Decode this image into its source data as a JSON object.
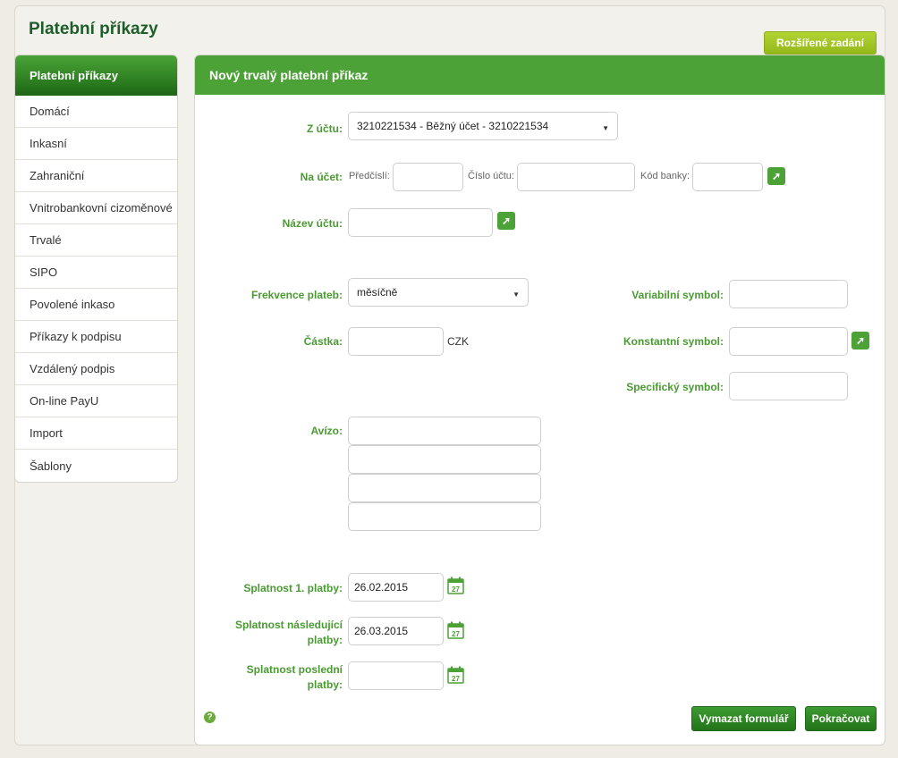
{
  "app": {
    "title": "Platební příkazy",
    "advanced_button": "Rozšířené zadání"
  },
  "sidebar": {
    "items": [
      {
        "label": "Platební příkazy",
        "active": true
      },
      {
        "label": "Domácí"
      },
      {
        "label": "Inkasní"
      },
      {
        "label": "Zahraniční"
      },
      {
        "label": "Vnitrobankovní cizoměnové"
      },
      {
        "label": "Trvalé"
      },
      {
        "label": "SIPO"
      },
      {
        "label": "Povolené inkaso"
      },
      {
        "label": "Příkazy k podpisu"
      },
      {
        "label": "Vzdálený podpis"
      },
      {
        "label": "On-line PayU"
      },
      {
        "label": "Import"
      },
      {
        "label": "Šablony"
      }
    ]
  },
  "form": {
    "heading": "Nový trvalý platební příkaz",
    "from_account": {
      "label": "Z účtu:",
      "value": "3210221534 - Běžný účet - 3210221534"
    },
    "to_account": {
      "label": "Na účet:",
      "prefix_label": "Předčíslí:",
      "prefix_value": "",
      "number_label": "Číslo účtu:",
      "number_value": "",
      "bank_label": "Kód banky:",
      "bank_value": ""
    },
    "account_name": {
      "label": "Název účtu:",
      "value": ""
    },
    "frequency": {
      "label": "Frekvence plateb:",
      "value": "měsíčně"
    },
    "amount": {
      "label": "Částka:",
      "value": "",
      "currency": "CZK"
    },
    "variable_symbol": {
      "label": "Variabilní symbol:",
      "value": ""
    },
    "constant_symbol": {
      "label": "Konstantní symbol:",
      "value": ""
    },
    "specific_symbol": {
      "label": "Specifický symbol:",
      "value": ""
    },
    "advice": {
      "label": "Avízo:",
      "lines": [
        "",
        "",
        "",
        ""
      ]
    },
    "first_due": {
      "label": "Splatnost 1. platby:",
      "value": "26.02.2015"
    },
    "next_due": {
      "label_1": "Splatnost následující",
      "label_2": "platby:",
      "value": "26.03.2015"
    },
    "last_due": {
      "label_1": "Splatnost poslední",
      "label_2": "platby:",
      "value": ""
    },
    "calendar_day": "27"
  },
  "actions": {
    "clear": "Vymazat formulář",
    "continue": "Pokračovat",
    "help": "?"
  },
  "icons": {
    "go": "arrow-up-right-icon",
    "calendar": "calendar-icon",
    "dropdown": "caret-down-icon"
  },
  "colors": {
    "brand_green": "#4ca137",
    "dark_green": "#1d5e2a",
    "lime": "#a3c52a",
    "label_green": "#4a9a32"
  }
}
